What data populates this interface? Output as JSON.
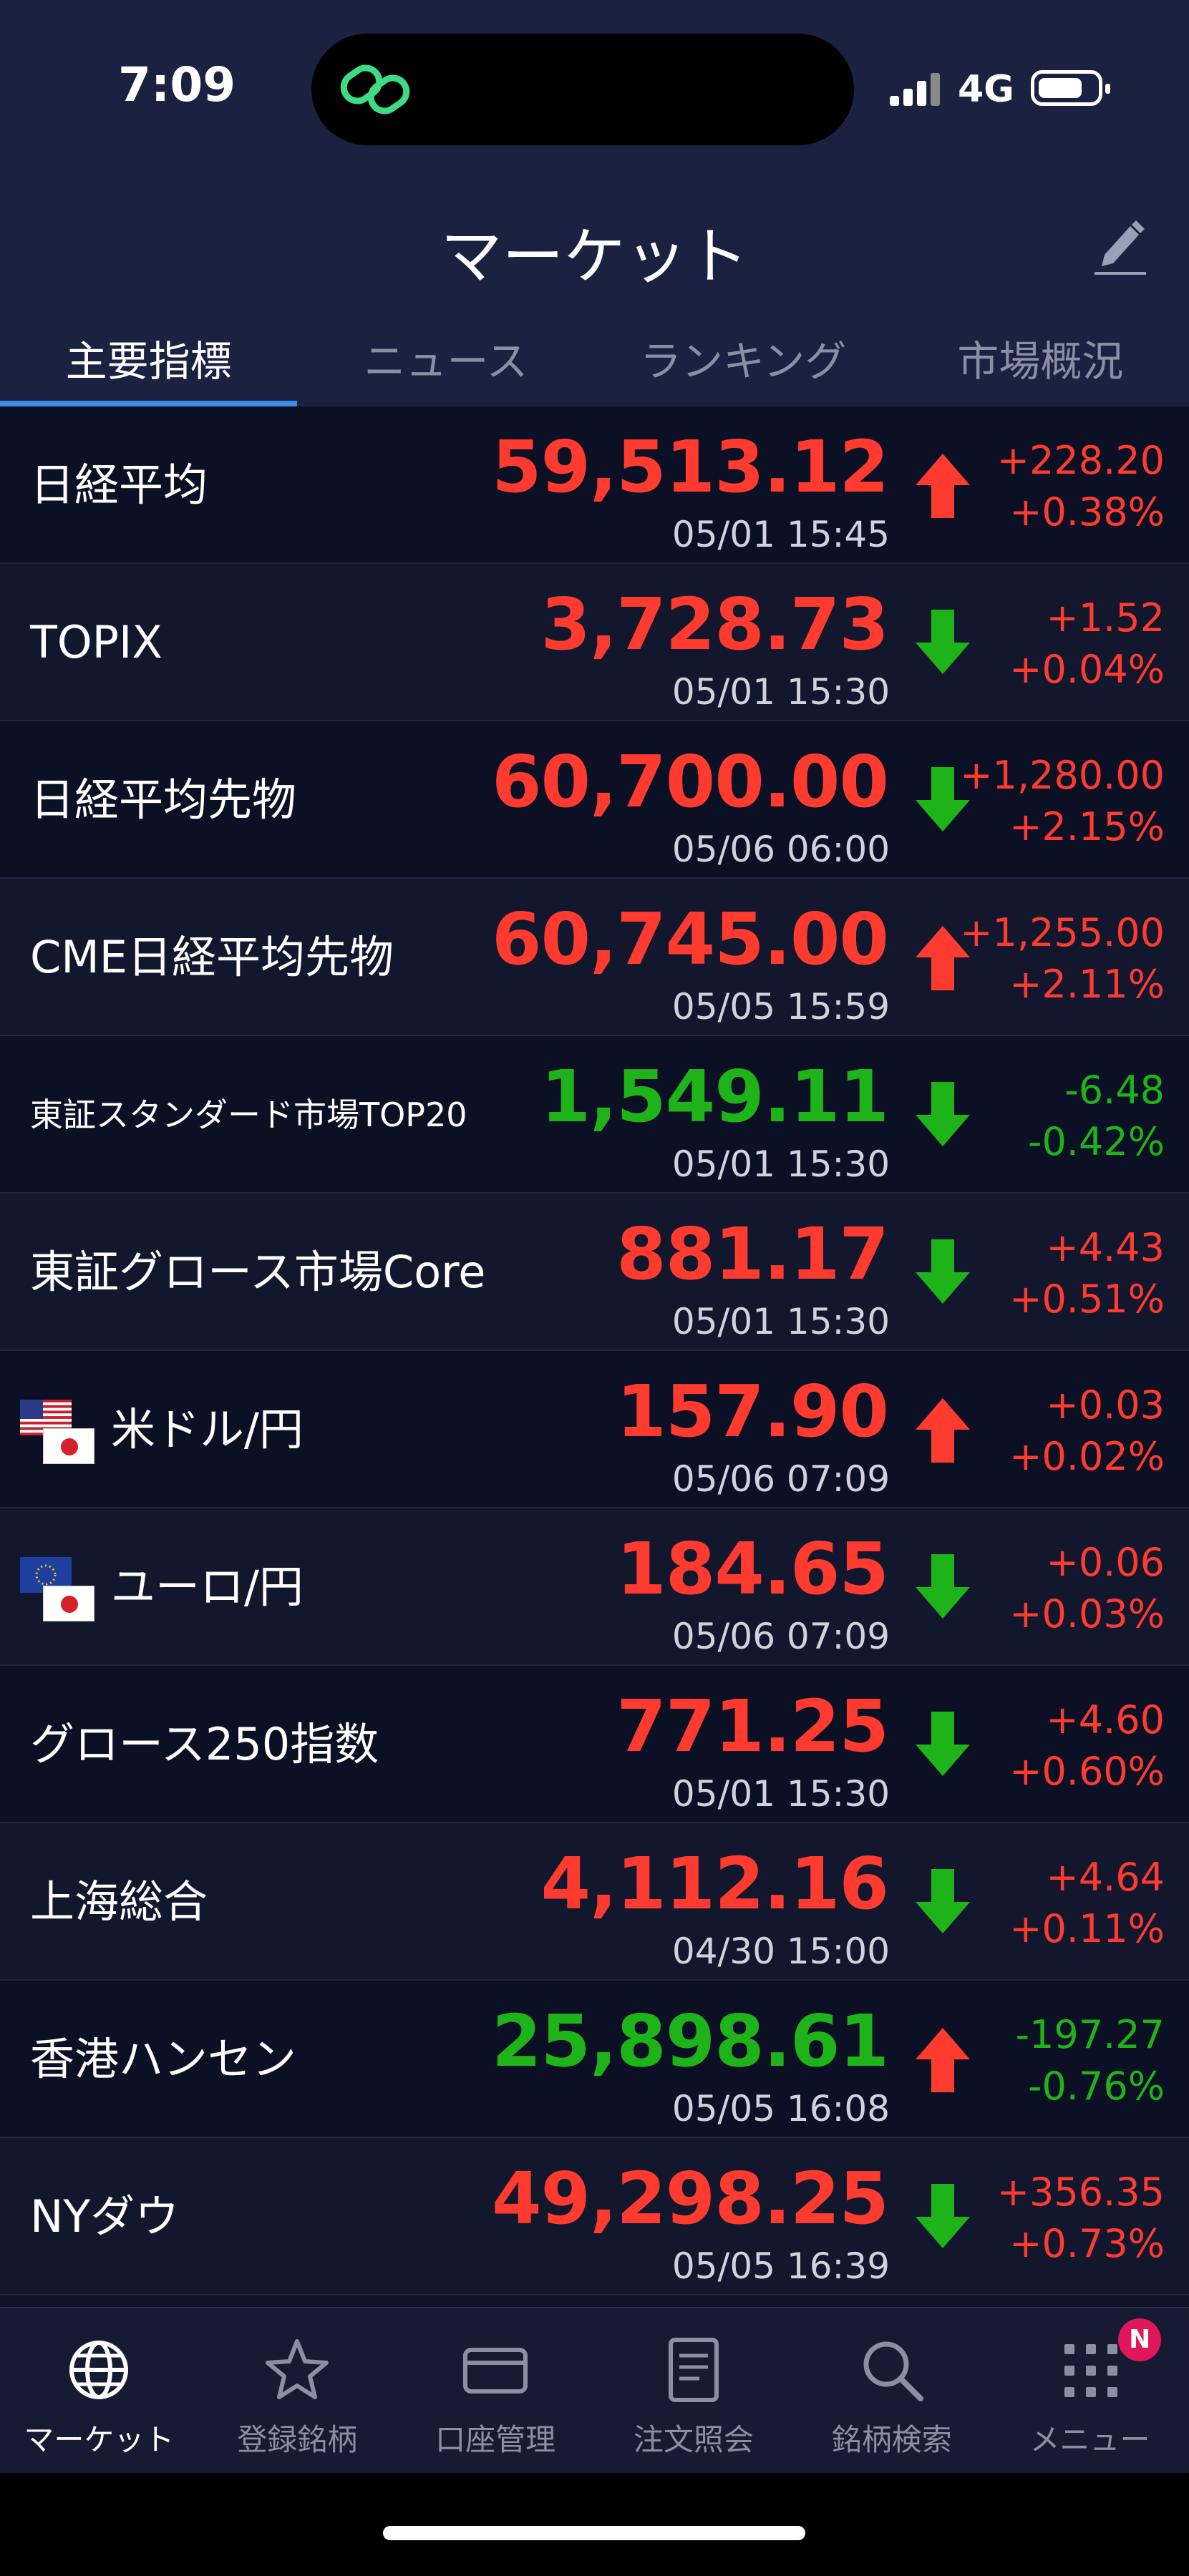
{
  "status_bar": {
    "time": "7:09",
    "network": "4G"
  },
  "header": {
    "title": "マーケット"
  },
  "tabs": [
    {
      "label": "主要指標",
      "active": true
    },
    {
      "label": "ニュース",
      "active": false
    },
    {
      "label": "ランキング",
      "active": false
    },
    {
      "label": "市場概況",
      "active": false
    }
  ],
  "rows": [
    {
      "name": "日経平均",
      "value": "59,513.12",
      "time": "05/01 15:45",
      "change": "+228.20",
      "percent": "+0.38%",
      "value_color": "up",
      "change_color": "up",
      "arrow": "up"
    },
    {
      "name": "TOPIX",
      "value": "3,728.73",
      "time": "05/01 15:30",
      "change": "+1.52",
      "percent": "+0.04%",
      "value_color": "up",
      "change_color": "up",
      "arrow": "down"
    },
    {
      "name": "日経平均先物",
      "value": "60,700.00",
      "time": "05/06 06:00",
      "change": "+1,280.00",
      "percent": "+2.15%",
      "value_color": "up",
      "change_color": "up",
      "arrow": "down"
    },
    {
      "name": "CME日経平均先物",
      "value": "60,745.00",
      "time": "05/05 15:59",
      "change": "+1,255.00",
      "percent": "+2.11%",
      "value_color": "up",
      "change_color": "up",
      "arrow": "up"
    },
    {
      "name": "東証スタンダード市場TOP20",
      "value": "1,549.11",
      "time": "05/01 15:30",
      "change": "-6.48",
      "percent": "-0.42%",
      "value_color": "down",
      "change_color": "down",
      "arrow": "down"
    },
    {
      "name": "東証グロース市場Core",
      "value": "881.17",
      "time": "05/01 15:30",
      "change": "+4.43",
      "percent": "+0.51%",
      "value_color": "up",
      "change_color": "up",
      "arrow": "down"
    },
    {
      "name": "米ドル/円",
      "value": "157.90",
      "time": "05/06 07:09",
      "change": "+0.03",
      "percent": "+0.02%",
      "value_color": "up",
      "change_color": "up",
      "arrow": "up",
      "flag": "us"
    },
    {
      "name": "ユーロ/円",
      "value": "184.65",
      "time": "05/06 07:09",
      "change": "+0.06",
      "percent": "+0.03%",
      "value_color": "up",
      "change_color": "up",
      "arrow": "down",
      "flag": "eu"
    },
    {
      "name": "グロース250指数",
      "value": "771.25",
      "time": "05/01 15:30",
      "change": "+4.60",
      "percent": "+0.60%",
      "value_color": "up",
      "change_color": "up",
      "arrow": "down"
    },
    {
      "name": "上海総合",
      "value": "4,112.16",
      "time": "04/30 15:00",
      "change": "+4.64",
      "percent": "+0.11%",
      "value_color": "up",
      "change_color": "up",
      "arrow": "down"
    },
    {
      "name": "香港ハンセン",
      "value": "25,898.61",
      "time": "05/05 16:08",
      "change": "-197.27",
      "percent": "-0.76%",
      "value_color": "down",
      "change_color": "down",
      "arrow": "up"
    },
    {
      "name": "NYダウ",
      "value": "49,298.25",
      "time": "05/05 16:39",
      "change": "+356.35",
      "percent": "+0.73%",
      "value_color": "up",
      "change_color": "up",
      "arrow": "down"
    }
  ],
  "bottom_nav": [
    {
      "label": "マーケット",
      "icon": "globe-icon",
      "active": true
    },
    {
      "label": "登録銘柄",
      "icon": "star-icon",
      "active": false
    },
    {
      "label": "口座管理",
      "icon": "card-icon",
      "active": false
    },
    {
      "label": "注文照会",
      "icon": "document-icon",
      "active": false
    },
    {
      "label": "銘柄検索",
      "icon": "search-icon",
      "active": false
    },
    {
      "label": "メニュー",
      "icon": "grid-icon",
      "active": false,
      "badge": "N"
    }
  ],
  "colors": {
    "up": "#ff3b30",
    "down": "#1fb31a",
    "accent": "#3a8ee6",
    "badge": "#e0185a"
  }
}
